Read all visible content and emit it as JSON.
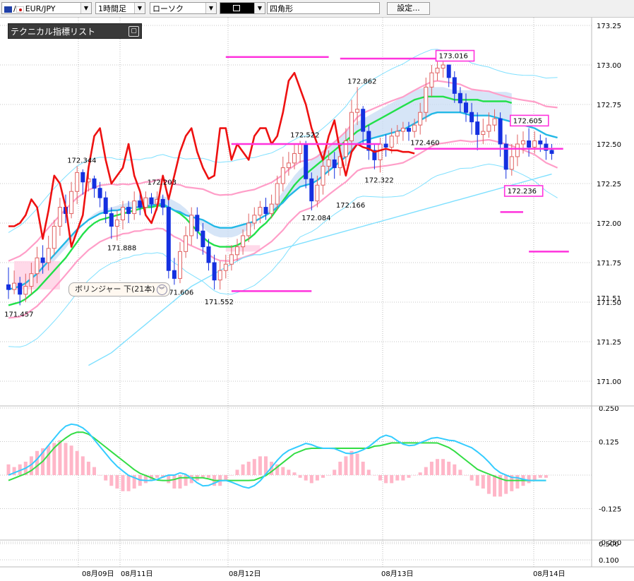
{
  "toolbar": {
    "pair": "EUR/JPY",
    "timeframe": "1時間足",
    "chart_type": "ローソク",
    "drawing_style_icon": "line-width-icon",
    "drawing_shape": "四角形",
    "settings_label": "設定..."
  },
  "indicator_panel": {
    "title": "テクニカル指標リスト"
  },
  "tooltip": {
    "text": "ボリンジャー 下(21本)"
  },
  "chart_data": {
    "type": "candlestick",
    "price_axis": {
      "min": 171.0,
      "max": 173.25,
      "ticks": [
        "173.25",
        "173.00",
        "172.75",
        "172.50",
        "172.25",
        "172.00",
        "171.75",
        "171.50",
        "171.25",
        "171.00"
      ],
      "current_price_label": "171.51"
    },
    "osc_axis": {
      "ticks": [
        "0.250",
        "0.125",
        "-0.125",
        "-0.250",
        "0.500",
        "0.100"
      ]
    },
    "date_labels": [
      "08月09日",
      "08月11日",
      "08月12日",
      "08月13日",
      "08月14日"
    ],
    "candles": [
      [
        171.61,
        171.58,
        171.72,
        171.52
      ],
      [
        171.58,
        171.62,
        171.7,
        171.55
      ],
      [
        171.62,
        171.55,
        171.66,
        171.48
      ],
      [
        171.55,
        171.6,
        171.68,
        171.5
      ],
      [
        171.6,
        171.68,
        171.75,
        171.55
      ],
      [
        171.68,
        171.78,
        171.85,
        171.62
      ],
      [
        171.78,
        171.75,
        171.86,
        171.68
      ],
      [
        171.75,
        171.84,
        171.92,
        171.7
      ],
      [
        171.84,
        171.98,
        172.02,
        171.8
      ],
      [
        171.98,
        172.1,
        172.16,
        171.92
      ],
      [
        172.1,
        172.06,
        172.18,
        172.0
      ],
      [
        172.06,
        172.2,
        172.26,
        172.03
      ],
      [
        172.2,
        172.32,
        172.36,
        172.12
      ],
      [
        172.32,
        172.26,
        172.34,
        172.18
      ],
      [
        172.26,
        172.28,
        172.32,
        172.2
      ],
      [
        172.28,
        172.22,
        172.3,
        172.16
      ],
      [
        172.22,
        172.16,
        172.26,
        172.1
      ],
      [
        172.16,
        172.06,
        172.2,
        172.0
      ],
      [
        172.06,
        171.98,
        172.1,
        171.9
      ],
      [
        171.98,
        172.02,
        172.08,
        171.89
      ],
      [
        172.02,
        172.1,
        172.14,
        171.96
      ],
      [
        172.1,
        172.06,
        172.14,
        172.0
      ],
      [
        172.06,
        172.14,
        172.2,
        172.02
      ],
      [
        172.14,
        172.1,
        172.2,
        172.05
      ],
      [
        172.1,
        172.16,
        172.2,
        172.05
      ],
      [
        172.16,
        172.12,
        172.19,
        172.06
      ],
      [
        172.12,
        172.15,
        172.2,
        172.08
      ],
      [
        172.15,
        172.1,
        172.18,
        172.05
      ],
      [
        172.1,
        171.7,
        172.16,
        171.65
      ],
      [
        171.7,
        171.65,
        171.78,
        171.61
      ],
      [
        171.65,
        171.82,
        171.88,
        171.62
      ],
      [
        171.82,
        171.92,
        171.98,
        171.78
      ],
      [
        171.92,
        172.05,
        172.1,
        171.86
      ],
      [
        172.05,
        171.95,
        172.1,
        171.9
      ],
      [
        171.95,
        171.85,
        172.0,
        171.8
      ],
      [
        171.85,
        171.75,
        171.9,
        171.7
      ],
      [
        171.75,
        171.64,
        171.8,
        171.58
      ],
      [
        171.64,
        171.7,
        171.76,
        171.58
      ],
      [
        171.7,
        171.74,
        171.8,
        171.65
      ],
      [
        171.74,
        171.8,
        171.86,
        171.7
      ],
      [
        171.8,
        171.85,
        171.9,
        171.76
      ],
      [
        171.85,
        171.92,
        171.96,
        171.8
      ],
      [
        171.92,
        172.0,
        172.06,
        171.88
      ],
      [
        172.0,
        172.05,
        172.1,
        171.96
      ],
      [
        172.05,
        172.1,
        172.14,
        172.0
      ],
      [
        172.1,
        172.06,
        172.16,
        172.02
      ],
      [
        172.06,
        172.12,
        172.18,
        172.03
      ],
      [
        172.12,
        172.25,
        172.3,
        172.08
      ],
      [
        172.25,
        172.35,
        172.42,
        172.2
      ],
      [
        172.35,
        172.38,
        172.45,
        172.3
      ],
      [
        172.38,
        172.44,
        172.5,
        172.34
      ],
      [
        172.44,
        172.5,
        172.52,
        172.38
      ],
      [
        172.5,
        172.28,
        172.52,
        172.22
      ],
      [
        172.28,
        172.14,
        172.32,
        172.08
      ],
      [
        172.14,
        172.24,
        172.3,
        172.1
      ],
      [
        172.24,
        172.36,
        172.4,
        172.18
      ],
      [
        172.36,
        172.4,
        172.46,
        172.3
      ],
      [
        172.4,
        172.35,
        172.45,
        172.28
      ],
      [
        172.35,
        172.42,
        172.48,
        172.3
      ],
      [
        172.42,
        172.52,
        172.6,
        172.36
      ],
      [
        172.52,
        172.7,
        172.78,
        172.46
      ],
      [
        172.7,
        172.72,
        172.86,
        172.62
      ],
      [
        172.72,
        172.58,
        172.74,
        172.5
      ],
      [
        172.58,
        172.46,
        172.62,
        172.4
      ],
      [
        172.46,
        172.4,
        172.5,
        172.34
      ],
      [
        172.4,
        172.5,
        172.54,
        172.32
      ],
      [
        172.5,
        172.48,
        172.56,
        172.42
      ],
      [
        172.48,
        172.55,
        172.6,
        172.44
      ],
      [
        172.55,
        172.58,
        172.62,
        172.5
      ],
      [
        172.58,
        172.6,
        172.64,
        172.52
      ],
      [
        172.6,
        172.58,
        172.64,
        172.52
      ],
      [
        172.58,
        172.62,
        172.66,
        172.54
      ],
      [
        172.62,
        172.7,
        172.76,
        172.56
      ],
      [
        172.7,
        172.86,
        172.92,
        172.64
      ],
      [
        172.86,
        172.95,
        173.0,
        172.8
      ],
      [
        172.95,
        172.98,
        173.02,
        172.9
      ],
      [
        172.98,
        173.0,
        173.02,
        172.92
      ],
      [
        173.0,
        172.92,
        173.0,
        172.86
      ],
      [
        172.92,
        172.82,
        172.96,
        172.76
      ],
      [
        172.82,
        172.76,
        172.86,
        172.7
      ],
      [
        172.76,
        172.7,
        172.82,
        172.64
      ],
      [
        172.7,
        172.64,
        172.76,
        172.56
      ],
      [
        172.64,
        172.56,
        172.7,
        172.46
      ],
      [
        172.56,
        172.58,
        172.66,
        172.5
      ],
      [
        172.58,
        172.62,
        172.7,
        172.54
      ],
      [
        172.62,
        172.66,
        172.72,
        172.58
      ],
      [
        172.66,
        172.5,
        172.7,
        172.42
      ],
      [
        172.5,
        172.34,
        172.56,
        172.28
      ],
      [
        172.34,
        172.42,
        172.5,
        172.3
      ],
      [
        172.42,
        172.5,
        172.56,
        172.36
      ],
      [
        172.5,
        172.52,
        172.58,
        172.44
      ],
      [
        172.52,
        172.48,
        172.6,
        172.42
      ],
      [
        172.48,
        172.52,
        172.58,
        172.44
      ],
      [
        172.52,
        172.5,
        172.56,
        172.45
      ],
      [
        172.5,
        172.46,
        172.54,
        172.4
      ],
      [
        172.46,
        172.44,
        172.5,
        172.4
      ]
    ],
    "labels": [
      {
        "text": "172.344",
        "i": 12,
        "price": 172.36,
        "pos": "above"
      },
      {
        "text": "171.457",
        "i": 1,
        "price": 171.47,
        "pos": "below"
      },
      {
        "text": "172.203",
        "i": 26,
        "price": 172.22,
        "pos": "above"
      },
      {
        "text": "171.888",
        "i": 19,
        "price": 171.89,
        "pos": "below"
      },
      {
        "text": "171.606",
        "i": 29,
        "price": 171.61,
        "pos": "below"
      },
      {
        "text": "171.552",
        "i": 36,
        "price": 171.55,
        "pos": "below"
      },
      {
        "text": "172.522",
        "i": 51,
        "price": 172.52,
        "pos": "above"
      },
      {
        "text": "172.084",
        "i": 53,
        "price": 172.08,
        "pos": "below"
      },
      {
        "text": "172.862",
        "i": 61,
        "price": 172.86,
        "pos": "above"
      },
      {
        "text": "172.166",
        "i": 59,
        "price": 172.16,
        "pos": "below"
      },
      {
        "text": "172.322",
        "i": 64,
        "price": 172.32,
        "pos": "below"
      },
      {
        "text": "172.460",
        "i": 72,
        "price": 172.47,
        "pos": "above"
      },
      {
        "text": "173.016",
        "i": 75,
        "price": 173.02,
        "pos": "above",
        "boxed": true
      },
      {
        "text": "172.605",
        "i": 88,
        "price": 172.61,
        "pos": "above",
        "boxed": true
      },
      {
        "text": "172.236",
        "i": 87,
        "price": 172.25,
        "pos": "below",
        "boxed": true
      }
    ],
    "bb_mid": [
      171.58,
      171.59,
      171.6,
      171.62,
      171.65,
      171.68,
      171.72,
      171.76,
      171.8,
      171.84,
      171.88,
      171.92,
      171.96,
      171.99,
      172.02,
      172.04,
      172.06,
      172.07,
      172.08,
      172.08,
      172.09,
      172.09,
      172.1,
      172.1,
      172.11,
      172.11,
      172.12,
      172.12,
      172.1,
      172.08,
      172.07,
      172.05,
      172.04,
      172.03,
      172.02,
      172.0,
      171.98,
      171.97,
      171.97,
      171.97,
      171.98,
      171.99,
      172.0,
      172.01,
      172.03,
      172.05,
      172.07,
      172.1,
      172.13,
      172.17,
      172.2,
      172.23,
      172.24,
      172.25,
      172.27,
      172.3,
      172.33,
      172.36,
      172.39,
      172.42,
      172.46,
      172.5,
      172.52,
      172.53,
      172.54,
      172.55,
      172.56,
      172.57,
      172.58,
      172.59,
      172.61,
      172.63,
      172.65,
      172.67,
      172.69,
      172.7,
      172.7,
      172.7,
      172.7,
      172.7,
      172.69,
      172.68,
      172.68,
      172.68,
      172.68,
      172.67,
      172.66,
      172.65,
      172.64,
      172.63,
      172.62,
      172.61,
      172.6,
      172.58,
      172.56,
      172.55,
      172.54
    ],
    "bb_band_offsets": [
      0.18,
      0.36
    ],
    "sma_green": [
      171.48,
      171.49,
      171.5,
      171.52,
      171.55,
      171.58,
      171.62,
      171.66,
      171.7,
      171.74,
      171.78,
      171.83,
      171.88,
      171.93,
      171.97,
      172.0,
      172.02,
      172.03,
      172.04,
      172.05,
      172.06,
      172.07,
      172.08,
      172.09,
      172.1,
      172.1,
      172.11,
      172.11,
      172.1,
      172.08,
      172.06,
      172.03,
      171.99,
      171.95,
      171.91,
      171.88,
      171.86,
      171.85,
      171.85,
      171.85,
      171.86,
      171.88,
      171.9,
      171.93,
      171.97,
      172.0,
      172.04,
      172.09,
      172.14,
      172.19,
      172.24,
      172.28,
      172.31,
      172.34,
      172.37,
      172.4,
      172.43,
      172.46,
      172.49,
      172.52,
      172.55,
      172.58,
      172.6,
      172.62,
      172.64,
      172.66,
      172.68,
      172.7,
      172.72,
      172.74,
      172.76,
      172.78,
      172.79,
      172.8,
      172.8,
      172.8,
      172.8,
      172.79,
      172.78,
      172.78,
      172.78,
      172.78,
      172.78,
      172.77,
      172.77,
      172.77,
      172.77,
      172.77,
      172.76
    ],
    "sma_aqua": [
      171.1,
      171.12,
      171.14,
      171.16,
      171.18,
      171.21,
      171.24,
      171.27,
      171.3,
      171.33,
      171.36,
      171.39,
      171.42,
      171.45,
      171.48,
      171.51,
      171.54,
      171.57,
      171.6,
      171.62,
      171.64,
      171.66,
      171.68,
      171.7,
      171.72,
      171.74,
      171.76,
      171.78,
      171.79,
      171.8,
      171.8,
      171.81,
      171.82,
      171.83,
      171.84,
      171.85,
      171.86,
      171.87,
      171.88,
      171.89,
      171.9,
      171.91,
      171.92,
      171.93,
      171.94,
      171.95,
      171.96,
      171.97,
      171.98,
      171.99,
      172.0,
      172.01,
      172.02,
      172.03,
      172.04,
      172.05,
      172.06,
      172.07,
      172.08,
      172.09,
      172.1,
      172.11,
      172.12,
      172.13,
      172.14,
      172.15,
      172.16,
      172.17,
      172.18,
      172.19,
      172.2,
      172.21,
      172.22,
      172.23,
      172.24,
      172.25,
      172.26,
      172.27,
      172.28,
      172.29,
      172.3,
      172.31
    ],
    "red_line": [
      171.98,
      171.98,
      172.0,
      172.05,
      172.15,
      172.1,
      171.9,
      172.08,
      172.3,
      172.25,
      172.1,
      171.85,
      171.95,
      172.05,
      172.35,
      172.55,
      172.6,
      172.4,
      172.25,
      172.3,
      172.35,
      172.5,
      172.3,
      172.2,
      172.05,
      172.0,
      172.1,
      172.3,
      172.15,
      172.3,
      172.45,
      172.55,
      172.6,
      172.45,
      172.35,
      172.28,
      172.3,
      172.6,
      172.6,
      172.4,
      172.5,
      172.45,
      172.4,
      172.55,
      172.6,
      172.6,
      172.5,
      172.55,
      172.7,
      172.9,
      172.95,
      172.85,
      172.75,
      172.6,
      172.5,
      172.4,
      172.55,
      172.65,
      172.45,
      172.3,
      172.45,
      172.5,
      172.48,
      172.47,
      172.45,
      172.46,
      172.47,
      172.46,
      172.46,
      172.45,
      172.45,
      172.44
    ],
    "hlines": [
      {
        "price": 173.05,
        "i0": 38,
        "i1": 56
      },
      {
        "price": 173.04,
        "i0": 58,
        "i1": 78
      },
      {
        "price": 172.5,
        "i0": 39,
        "i1": 65
      },
      {
        "price": 172.47,
        "i0": 71,
        "i1": 97
      },
      {
        "price": 171.57,
        "i0": 39,
        "i1": 53
      },
      {
        "price": 172.07,
        "i0": 86,
        "i1": 90
      },
      {
        "price": 171.82,
        "i0": 91,
        "i1": 98
      }
    ],
    "macd_hist": [
      0.04,
      0.03,
      0.04,
      0.05,
      0.07,
      0.09,
      0.1,
      0.11,
      0.12,
      0.13,
      0.12,
      0.11,
      0.09,
      0.07,
      0.05,
      0.03,
      0.0,
      -0.02,
      -0.04,
      -0.05,
      -0.06,
      -0.06,
      -0.05,
      -0.04,
      -0.03,
      -0.02,
      -0.01,
      -0.01,
      -0.03,
      -0.05,
      -0.05,
      -0.04,
      -0.03,
      -0.02,
      -0.01,
      -0.01,
      -0.04,
      -0.04,
      -0.02,
      0.0,
      0.02,
      0.04,
      0.05,
      0.06,
      0.07,
      0.07,
      0.05,
      0.04,
      0.03,
      0.02,
      0.01,
      -0.01,
      -0.02,
      -0.03,
      -0.02,
      -0.01,
      0.0,
      0.02,
      0.05,
      0.07,
      0.09,
      0.08,
      0.05,
      0.02,
      0.0,
      -0.02,
      -0.03,
      -0.03,
      -0.02,
      -0.02,
      -0.01,
      0.0,
      0.01,
      0.03,
      0.05,
      0.06,
      0.06,
      0.05,
      0.04,
      0.02,
      0.0,
      -0.02,
      -0.04,
      -0.05,
      -0.07,
      -0.08,
      -0.08,
      -0.07,
      -0.06,
      -0.05,
      -0.04,
      -0.03,
      -0.02,
      -0.01,
      -0.01
    ],
    "macd_line": [
      0.0,
      0.01,
      0.02,
      0.03,
      0.05,
      0.08,
      0.11,
      0.14,
      0.17,
      0.19,
      0.19,
      0.18,
      0.16,
      0.13,
      0.1,
      0.07,
      0.04,
      0.02,
      0.0,
      -0.01,
      -0.02,
      -0.02,
      -0.02,
      -0.01,
      0.0,
      0.0,
      0.01,
      0.0,
      -0.02,
      -0.04,
      -0.04,
      -0.03,
      -0.02,
      -0.02,
      -0.03,
      -0.04,
      -0.05,
      -0.04,
      -0.02,
      0.01,
      0.04,
      0.07,
      0.09,
      0.1,
      0.11,
      0.12,
      0.11,
      0.1,
      0.1,
      0.1,
      0.09,
      0.08,
      0.08,
      0.09,
      0.1,
      0.12,
      0.14,
      0.15,
      0.14,
      0.12,
      0.11,
      0.11,
      0.12,
      0.13,
      0.14,
      0.14,
      0.13,
      0.13,
      0.12,
      0.11,
      0.1,
      0.08,
      0.06,
      0.03,
      0.01,
      0.0,
      -0.01,
      -0.01,
      -0.02,
      -0.02,
      -0.02,
      -0.02
    ],
    "signal_line": [
      -0.02,
      -0.01,
      0.0,
      0.01,
      0.03,
      0.05,
      0.08,
      0.11,
      0.13,
      0.15,
      0.16,
      0.16,
      0.15,
      0.13,
      0.11,
      0.09,
      0.07,
      0.05,
      0.03,
      0.01,
      0.0,
      -0.01,
      -0.02,
      -0.02,
      -0.02,
      -0.01,
      -0.01,
      -0.01,
      -0.01,
      -0.01,
      -0.02,
      -0.02,
      -0.02,
      -0.02,
      -0.02,
      -0.02,
      -0.02,
      -0.01,
      0.0,
      0.02,
      0.04,
      0.06,
      0.08,
      0.09,
      0.1,
      0.1,
      0.1,
      0.1,
      0.1,
      0.1,
      0.1,
      0.1,
      0.1,
      0.1,
      0.11,
      0.11,
      0.12,
      0.12,
      0.12,
      0.12,
      0.12,
      0.12,
      0.12,
      0.12,
      0.11,
      0.1,
      0.08,
      0.06,
      0.04,
      0.02,
      0.01,
      0.0,
      -0.01,
      -0.02,
      -0.02,
      -0.02,
      -0.02,
      -0.02,
      -0.02,
      -0.02
    ],
    "colors": {
      "up": "#e06060",
      "down": "#1530e0",
      "bb_mid": "#22b8e6",
      "bb_inner": "#ff9ec8",
      "bb_outer": "#7fe0ff",
      "sma_green": "#22e04a",
      "red_line": "#ee1111",
      "hline": "#ff33dd",
      "hist": "#ffb6c8",
      "macd": "#33ccff",
      "signal": "#33dd44",
      "cloud": "#c8dcf4",
      "cloud_pink": "#ffd0e4",
      "grid": "#909090"
    }
  }
}
